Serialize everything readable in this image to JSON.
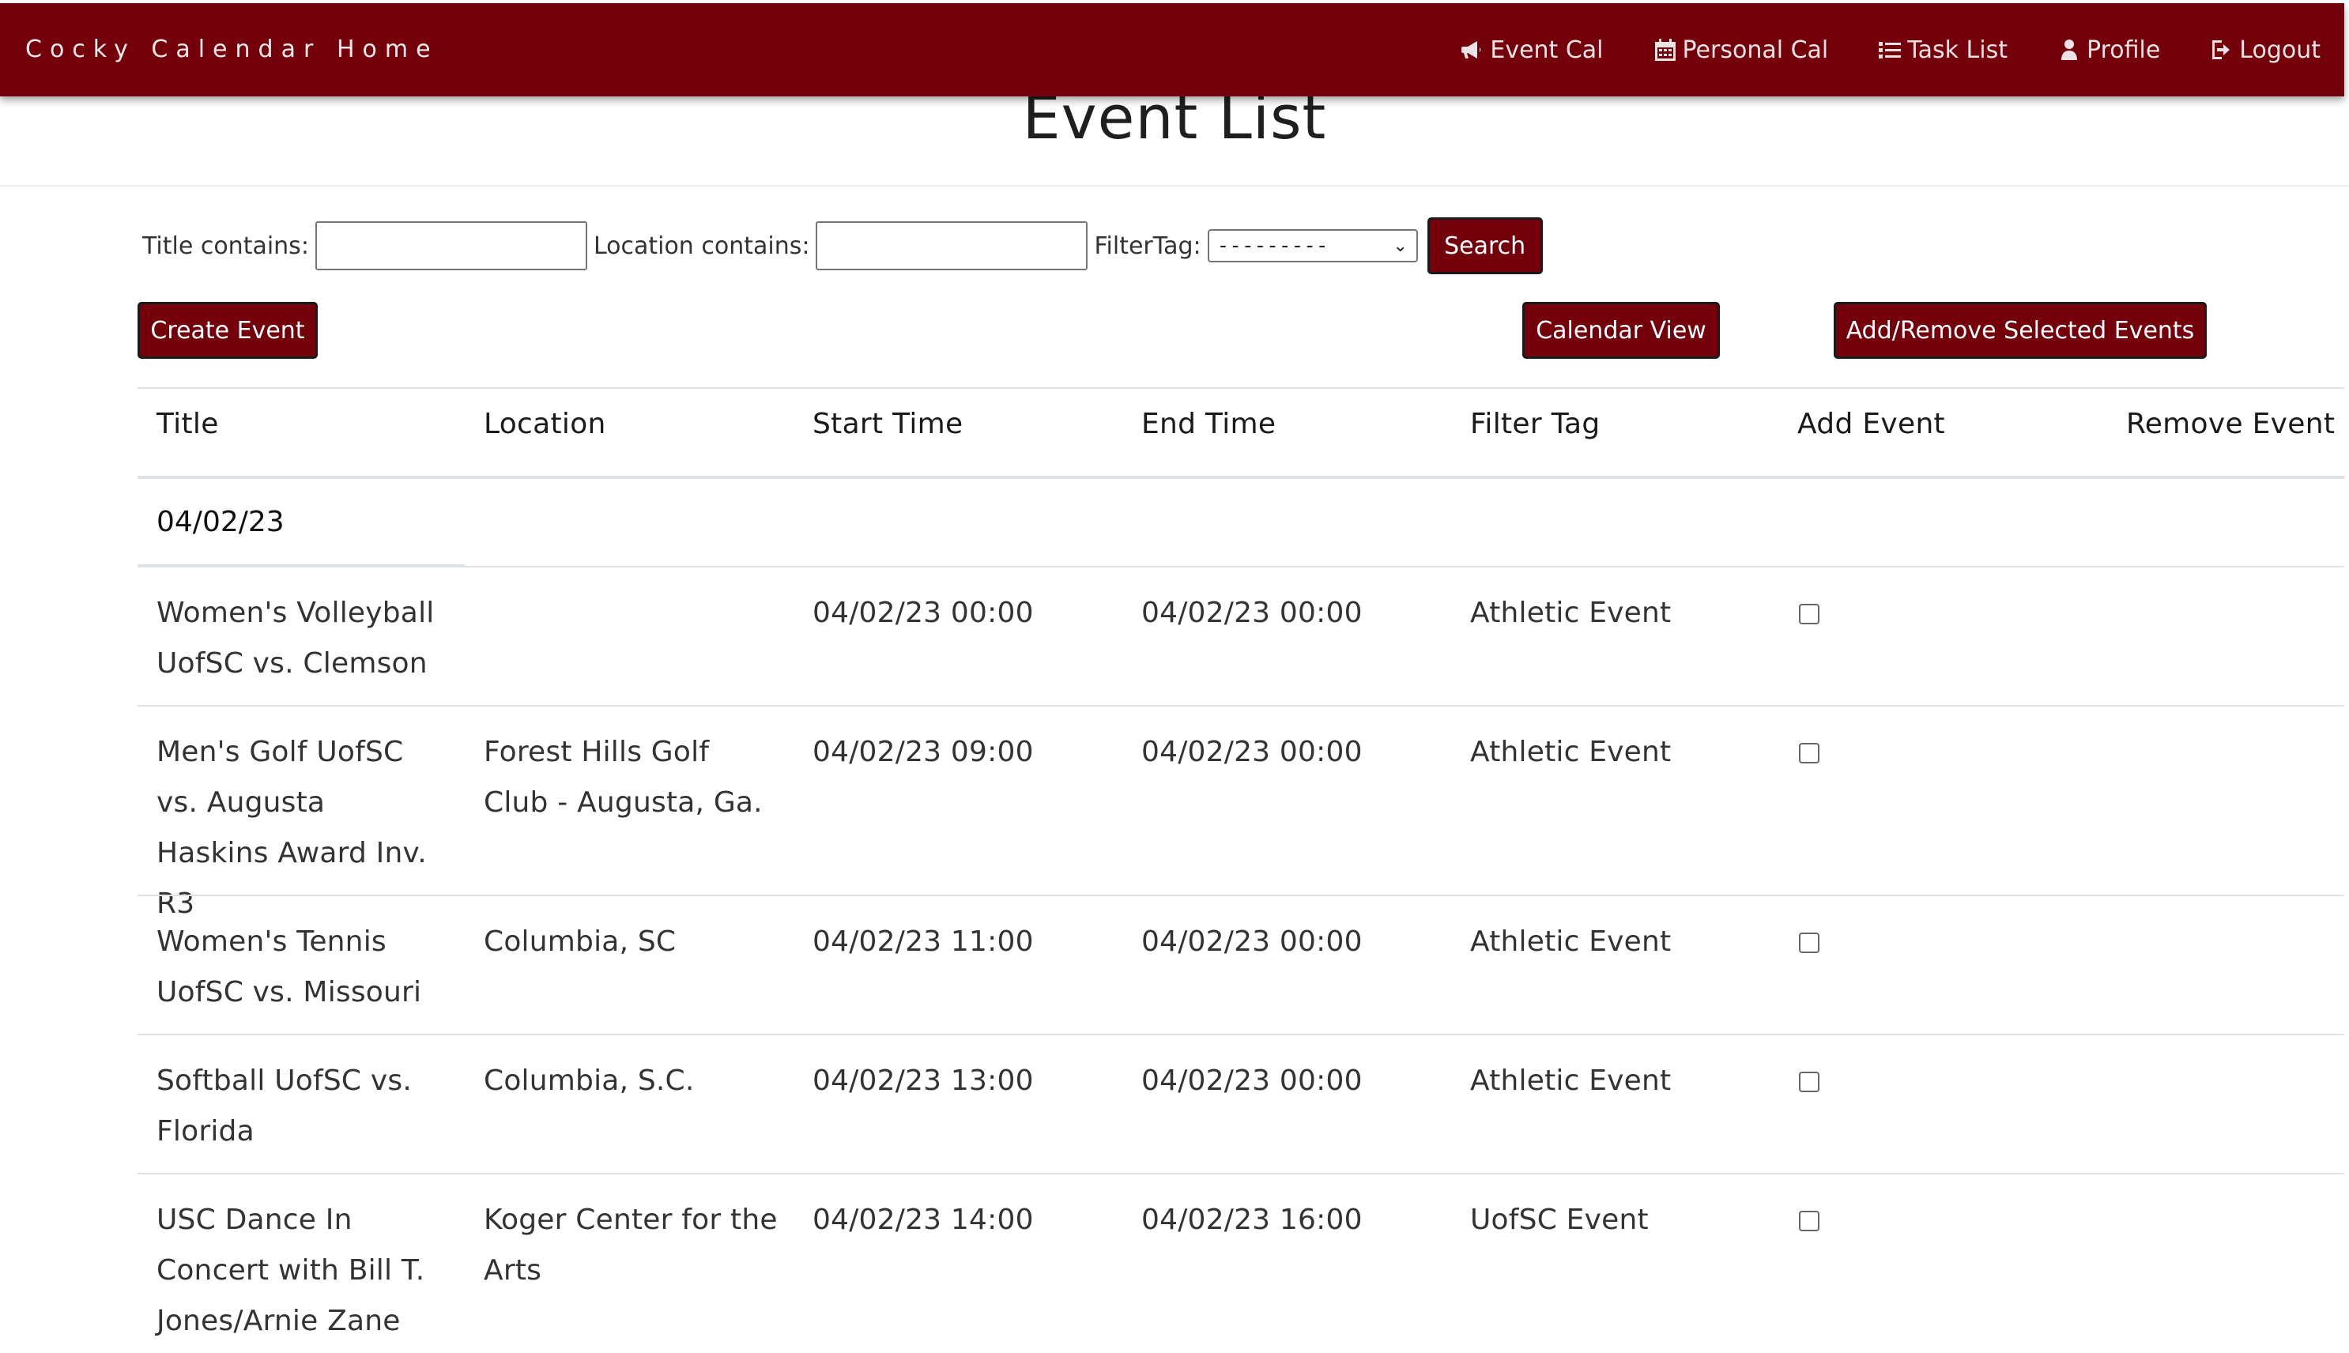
{
  "navbar": {
    "brand": "Cocky Calendar",
    "home": "Home",
    "links": [
      {
        "label": "Event Cal",
        "icon": "bullhorn-icon"
      },
      {
        "label": "Personal Cal",
        "icon": "calendar-icon"
      },
      {
        "label": "Task List",
        "icon": "list-icon"
      },
      {
        "label": "Profile",
        "icon": "user-icon"
      },
      {
        "label": "Logout",
        "icon": "logout-icon"
      }
    ],
    "color": "#73000a"
  },
  "page": {
    "title": "Event List"
  },
  "filters": {
    "title_label": "Title contains:",
    "title_value": "",
    "location_label": "Location contains:",
    "location_value": "",
    "tag_label": "FilterTag:",
    "tag_selected": "---------",
    "search_label": "Search"
  },
  "actions": {
    "create_label": "Create Event",
    "calendar_label": "Calendar View",
    "add_remove_label": "Add/Remove Selected Events"
  },
  "table": {
    "columns": [
      "Title",
      "Location",
      "Start Time",
      "End Time",
      "Filter Tag",
      "Add Event",
      "Remove Event"
    ],
    "date_group": "04/02/23",
    "rows": [
      {
        "title": "Women's Volleyball UofSC vs. Clemson",
        "location": "",
        "start": "04/02/23 00:00",
        "end": "04/02/23 00:00",
        "tag": "Athletic Event",
        "add_checked": false
      },
      {
        "title": "Men's Golf UofSC vs. Augusta Haskins Award Inv. R3",
        "location": "Forest Hills Golf Club - Augusta, Ga.",
        "start": "04/02/23 09:00",
        "end": "04/02/23 00:00",
        "tag": "Athletic Event",
        "add_checked": false
      },
      {
        "title": "Women's Tennis UofSC vs. Missouri",
        "location": "Columbia, SC",
        "start": "04/02/23 11:00",
        "end": "04/02/23 00:00",
        "tag": "Athletic Event",
        "add_checked": false
      },
      {
        "title": "Softball UofSC vs. Florida",
        "location": "Columbia, S.C.",
        "start": "04/02/23 13:00",
        "end": "04/02/23 00:00",
        "tag": "Athletic Event",
        "add_checked": false
      },
      {
        "title": "USC Dance In Concert with Bill T. Jones/Arnie Zane",
        "location": "Koger Center for the Arts",
        "start": "04/02/23 14:00",
        "end": "04/02/23 16:00",
        "tag": "UofSC Event",
        "add_checked": false
      }
    ]
  }
}
